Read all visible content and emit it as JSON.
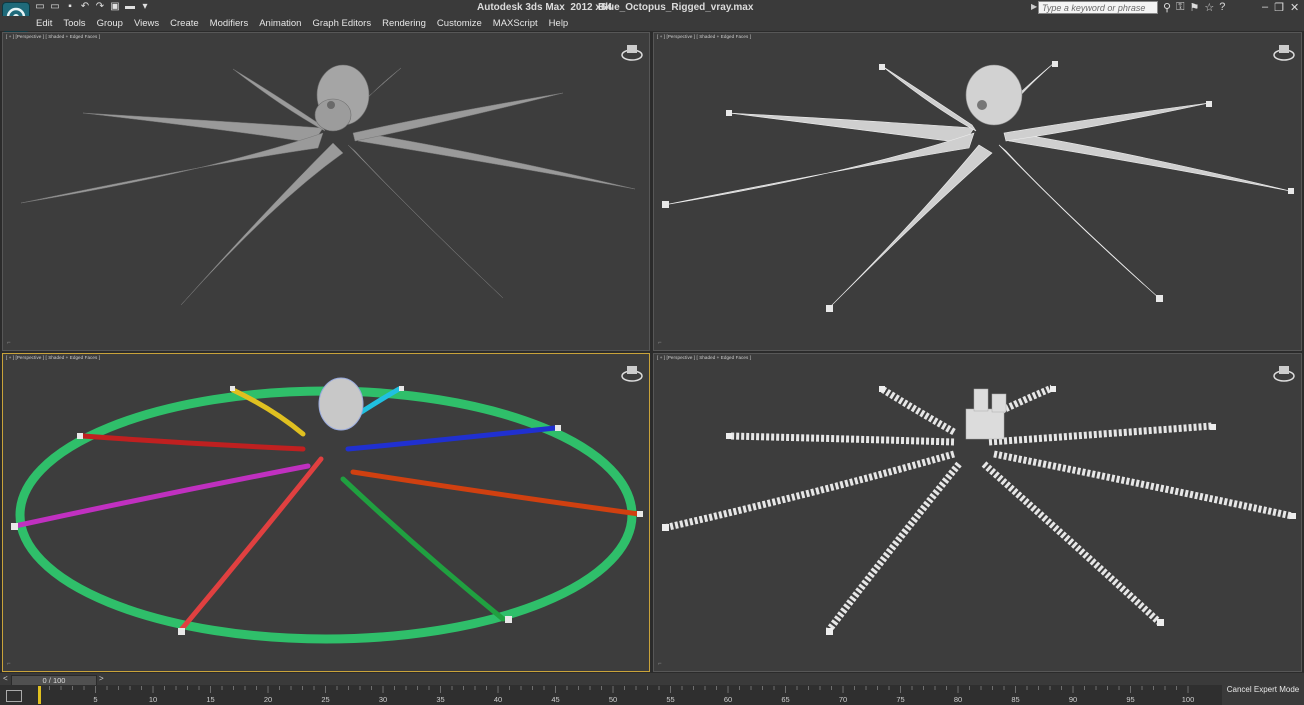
{
  "titlebar": {
    "app_title": "Autodesk 3ds Max  2012 x64",
    "file_name": "Blue_Octopus_Rigged_vray.max",
    "search_placeholder": "Type a keyword or phrase"
  },
  "menu": [
    "Edit",
    "Tools",
    "Group",
    "Views",
    "Create",
    "Modifiers",
    "Animation",
    "Graph Editors",
    "Rendering",
    "Customize",
    "MAXScript",
    "Help"
  ],
  "viewports": [
    {
      "label": "[ + ] [Perspective ] [ Shaded + Edged Faces ]"
    },
    {
      "label": "[ + ] [Perspective ] [ Shaded + Edged Faces ]"
    },
    {
      "label": "[ + ] [Perspective ] [ Shaded + Edged Faces ]"
    },
    {
      "label": "[ + ] [Perspective ] [ Shaded + Edged Faces ]"
    }
  ],
  "timeline": {
    "frame_display": "0 / 100",
    "ticks": [
      "0",
      "5",
      "10",
      "15",
      "20",
      "25",
      "30",
      "35",
      "40",
      "45",
      "50",
      "55",
      "60",
      "65",
      "70",
      "75",
      "80",
      "85",
      "90",
      "95",
      "100"
    ]
  },
  "status": {
    "cancel_expert_mode": "Cancel Expert Mode"
  },
  "colors": {
    "accent_border": "#c9a33a",
    "ring": "#2fbf6a",
    "tentacle_colors": [
      "#e0c020",
      "#20c0e0",
      "#2030d0",
      "#d04010",
      "#20a040",
      "#e04040",
      "#c030c0",
      "#c02020"
    ]
  }
}
